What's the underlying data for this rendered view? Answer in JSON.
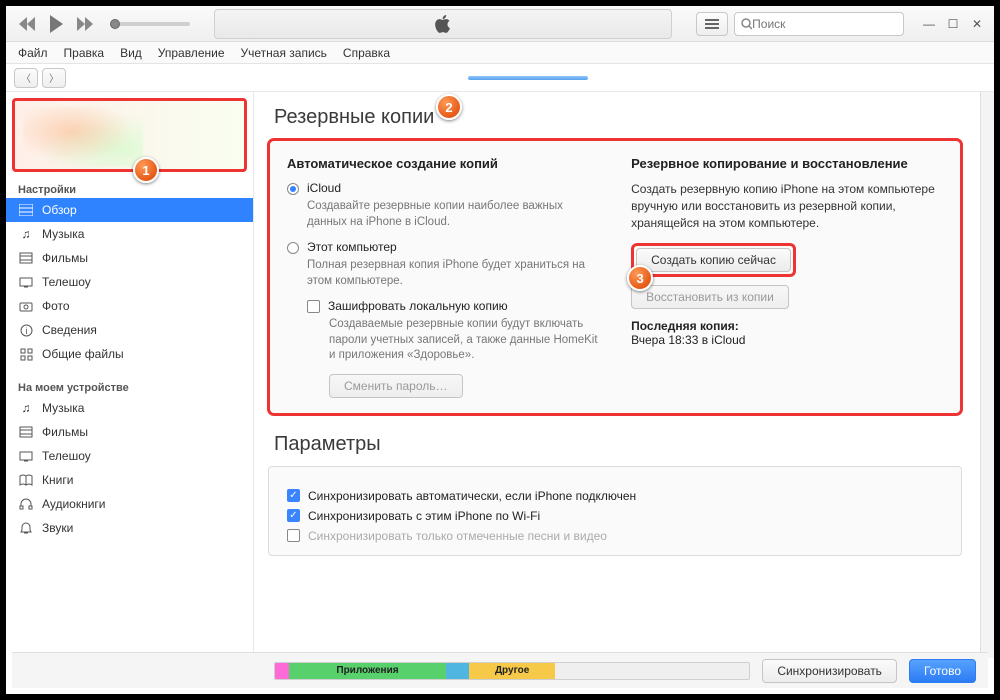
{
  "titlebar": {
    "search_placeholder": "Поиск"
  },
  "menu": [
    "Файл",
    "Правка",
    "Вид",
    "Управление",
    "Учетная запись",
    "Справка"
  ],
  "sidebar": {
    "section1": "Настройки",
    "items1": [
      {
        "label": "Обзор",
        "selected": true
      },
      {
        "label": "Музыка"
      },
      {
        "label": "Фильмы"
      },
      {
        "label": "Телешоу"
      },
      {
        "label": "Фото"
      },
      {
        "label": "Сведения"
      },
      {
        "label": "Общие файлы"
      }
    ],
    "section2": "На моем устройстве",
    "items2": [
      {
        "label": "Музыка"
      },
      {
        "label": "Фильмы"
      },
      {
        "label": "Телешоу"
      },
      {
        "label": "Книги"
      },
      {
        "label": "Аудиокниги"
      },
      {
        "label": "Звуки"
      }
    ]
  },
  "backup": {
    "title": "Резервные копии",
    "auto_title": "Автоматическое создание копий",
    "icloud_label": "iCloud",
    "icloud_hint": "Создавайте резервные копии наиболее важных данных на iPhone в iCloud.",
    "this_pc_label": "Этот компьютер",
    "this_pc_hint": "Полная резервная копия iPhone будет храниться на этом компьютере.",
    "encrypt_label": "Зашифровать локальную копию",
    "encrypt_hint": "Создаваемые резервные копии будут включать пароли учетных записей, а также данные HomeKit и приложения «Здоровье».",
    "change_pwd": "Сменить пароль…",
    "restore_title": "Резервное копирование и восстановление",
    "restore_hint": "Создать резервную копию iPhone на этом компьютере вручную или восстановить из резервной копии, хранящейся на этом компьютере.",
    "backup_now": "Создать копию сейчас",
    "restore_from": "Восстановить из копии",
    "last_label": "Последняя копия:",
    "last_value": "Вчера 18:33 в iCloud"
  },
  "options": {
    "title": "Параметры",
    "opt1": "Синхронизировать автоматически, если iPhone подключен",
    "opt2": "Синхронизировать с этим iPhone по Wi-Fi",
    "opt3": "Синхронизировать только отмеченные песни и видео"
  },
  "storage": {
    "apps": "Приложения",
    "other": "Другое"
  },
  "footer": {
    "sync": "Синхронизировать",
    "done": "Готово"
  },
  "callouts": {
    "c1": "1",
    "c2": "2",
    "c3": "3"
  }
}
